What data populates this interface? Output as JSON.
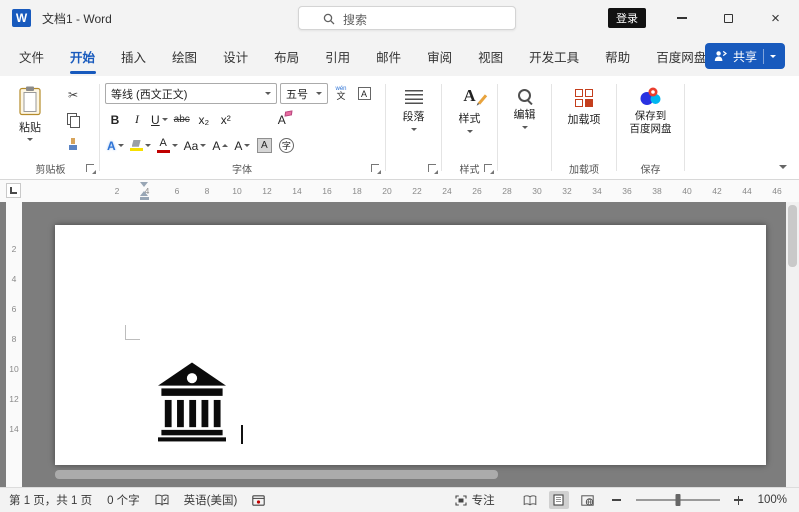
{
  "titlebar": {
    "title": "文档1 - Word",
    "search_placeholder": "搜索",
    "login_label": "登录"
  },
  "tabs": [
    {
      "label": "文件",
      "active": false
    },
    {
      "label": "开始",
      "active": true
    },
    {
      "label": "插入",
      "active": false
    },
    {
      "label": "绘图",
      "active": false
    },
    {
      "label": "设计",
      "active": false
    },
    {
      "label": "布局",
      "active": false
    },
    {
      "label": "引用",
      "active": false
    },
    {
      "label": "邮件",
      "active": false
    },
    {
      "label": "审阅",
      "active": false
    },
    {
      "label": "视图",
      "active": false
    },
    {
      "label": "开发工具",
      "active": false
    },
    {
      "label": "帮助",
      "active": false
    },
    {
      "label": "百度网盘",
      "active": false
    }
  ],
  "share_label": "共享",
  "ribbon": {
    "clipboard": {
      "paste_label": "粘贴",
      "group_label": "剪贴板"
    },
    "font": {
      "group_label": "字体",
      "font_name": "等线 (西文正文)",
      "font_size": "五号",
      "bold": "B",
      "italic": "I",
      "underline": "U",
      "strikethrough": "abc",
      "subscript": "x₂",
      "superscript": "x²",
      "clear_format": "A",
      "text_effects": "A",
      "change_case": "Aa",
      "grow_font": "A",
      "shrink_font": "A",
      "font_color": "A",
      "char_shading": "A",
      "enclose_char": "字",
      "char_border": "A",
      "phonetic_top": "wén",
      "phonetic_bottom": "文"
    },
    "paragraph": {
      "button_label": "段落"
    },
    "styles": {
      "button_label": "样式",
      "group_label": "样式"
    },
    "editing": {
      "button_label": "编辑"
    },
    "addins": {
      "button_label": "加载项",
      "group_label": "加载项"
    },
    "baidu_save": {
      "button_line1": "保存到",
      "button_line2": "百度网盘",
      "group_label": "保存"
    }
  },
  "ruler": {
    "horizontal_numbers": [
      "2",
      "4",
      "6",
      "8",
      "10",
      "12",
      "14",
      "16",
      "18",
      "20",
      "22",
      "24",
      "26",
      "28",
      "30",
      "32",
      "34",
      "36",
      "38",
      "40",
      "42",
      "44",
      "46"
    ],
    "vertical_numbers": [
      "2",
      "4",
      "6",
      "8",
      "10",
      "12",
      "14"
    ]
  },
  "statusbar": {
    "page_info": "第 1 页，共 1 页",
    "word_count": "0 个字",
    "language": "英语(美国)",
    "focus_label": "专注",
    "zoom_percent": "100%"
  },
  "colors": {
    "accent_blue": "#185abd",
    "document_background": "#7d7d7d",
    "addin_red": "#c43e1c",
    "highlight_yellow": "#f7e000",
    "font_color_red": "#c00000",
    "login_black": "#121212"
  }
}
